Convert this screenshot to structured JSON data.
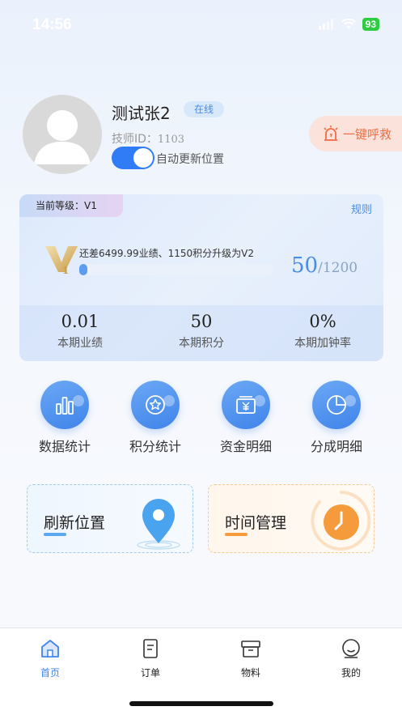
{
  "status_bar": {
    "time": "14:56",
    "battery": "93"
  },
  "profile": {
    "name": "测试张2",
    "status_badge": "在线",
    "tech_id_label": "技师ID：",
    "tech_id_value": "1103",
    "auto_update_label": "自动更新位置",
    "auto_update_on": true
  },
  "sos": {
    "label": "一键呼救",
    "icon": "alarm-light-icon"
  },
  "level_card": {
    "current_level_label": "当前等级：V1",
    "rules_link": "规则",
    "badge_text": "V1",
    "progress_desc": "还差6499.99业绩、1150积分升级为V2",
    "progress_current": "50",
    "progress_max": "/1200",
    "progress_fraction": 0.042,
    "stats": [
      {
        "value": "0.01",
        "label": "本期业绩"
      },
      {
        "value": "50",
        "label": "本期积分"
      },
      {
        "value": "0%",
        "label": "本期加钟率"
      }
    ]
  },
  "quick_actions": [
    {
      "label": "数据统计",
      "icon": "bar-chart-icon"
    },
    {
      "label": "积分统计",
      "icon": "star-medal-icon"
    },
    {
      "label": "资金明细",
      "icon": "yuan-wallet-icon"
    },
    {
      "label": "分成明细",
      "icon": "pie-chart-icon"
    }
  ],
  "action_cards": {
    "refresh": {
      "label": "刷新位置",
      "icon": "location-pin-icon"
    },
    "time": {
      "label": "时间管理",
      "icon": "clock-icon"
    }
  },
  "tab_bar": {
    "items": [
      {
        "label": "首页",
        "icon": "home-icon",
        "active": true
      },
      {
        "label": "订单",
        "icon": "order-list-icon",
        "active": false
      },
      {
        "label": "物料",
        "icon": "box-icon",
        "active": false
      },
      {
        "label": "我的",
        "icon": "smile-user-icon",
        "active": false
      }
    ]
  },
  "colors": {
    "accent": "#3f84ea",
    "sos": "#f16d44",
    "clock": "#f69b3c"
  }
}
